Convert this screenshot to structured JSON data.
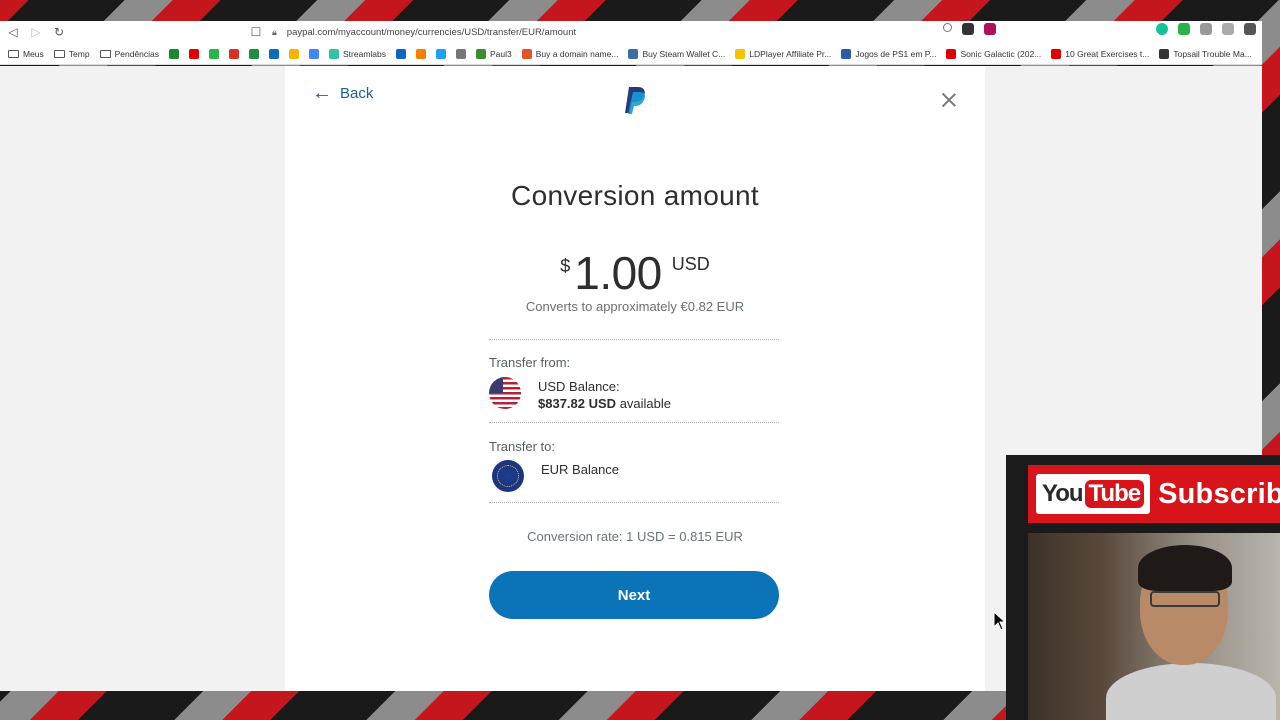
{
  "browser": {
    "url": "paypal.com/myaccount/money/currencies/USD/transfer/EUR/amount",
    "bookmarks": [
      {
        "label": "Meus",
        "icon": "folder-icon"
      },
      {
        "label": "Temp",
        "icon": "folder-icon"
      },
      {
        "label": "Pendências",
        "icon": "folder-icon"
      },
      {
        "label": "",
        "icon": "h-icon",
        "color": "#1b8a2e"
      },
      {
        "label": "",
        "icon": "youtube-icon",
        "color": "#e00000"
      },
      {
        "label": "",
        "icon": "green-circle-icon",
        "color": "#2bb34b"
      },
      {
        "label": "",
        "icon": "gmail-icon",
        "color": "#d93025"
      },
      {
        "label": "",
        "icon": "sheets-icon",
        "color": "#1e8e3e"
      },
      {
        "label": "",
        "icon": "outlook-icon",
        "color": "#0f6cbd"
      },
      {
        "label": "",
        "icon": "drive-icon",
        "color": "#f4b400"
      },
      {
        "label": "",
        "icon": "translate-icon",
        "color": "#4285f4"
      },
      {
        "label": "Streamlabs",
        "icon": "streamlabs-icon",
        "color": "#31c3a2"
      },
      {
        "label": "",
        "icon": "cloud-icon",
        "color": "#0a66c2"
      },
      {
        "label": "",
        "icon": "blogger-icon",
        "color": "#f57d00"
      },
      {
        "label": "",
        "icon": "twitter-icon",
        "color": "#1da1f2"
      },
      {
        "label": "",
        "icon": "google-icon",
        "color": "#777777"
      },
      {
        "label": "Paul3",
        "icon": "paul-icon",
        "color": "#3c8d2f"
      },
      {
        "label": "Buy a domain name...",
        "icon": "domain-icon",
        "color": "#e2542a"
      },
      {
        "label": "Buy Steam Wallet C...",
        "icon": "steam-icon",
        "color": "#3a6ea5"
      },
      {
        "label": "LDPlayer Affiliate Pr...",
        "icon": "ldplayer-icon",
        "color": "#f2c500"
      },
      {
        "label": "Jogos de PS1 em P...",
        "icon": "ps1-icon",
        "color": "#2a5caa"
      },
      {
        "label": "Sonic Galactic (202...",
        "icon": "youtube-icon",
        "color": "#e00000"
      },
      {
        "label": "10 Great Exercises t...",
        "icon": "youtube-icon",
        "color": "#e00000"
      },
      {
        "label": "Topsail Trouble Ma...",
        "icon": "topsail-icon",
        "color": "#333333"
      }
    ]
  },
  "paypal": {
    "back_label": "Back",
    "title": "Conversion amount",
    "amount": {
      "symbol": "$",
      "value": "1.00",
      "currency": "USD",
      "converts_text": "Converts to approximately €0.82 EUR"
    },
    "transfer_from": {
      "label": "Transfer from:",
      "balance_name": "USD Balance:",
      "available_amount": "$837.82 USD",
      "available_suffix": "available"
    },
    "transfer_to": {
      "label": "Transfer to:",
      "balance_name": "EUR Balance"
    },
    "conversion_rate": "Conversion rate: 1 USD = 0.815 EUR",
    "next_label": "Next",
    "colors": {
      "primary_button": "#0b73b7",
      "link": "#1b5f8e"
    }
  },
  "overlay": {
    "youtube_logo_you": "You",
    "youtube_logo_tube": "Tube",
    "subscribe_text": "Subscribe"
  }
}
